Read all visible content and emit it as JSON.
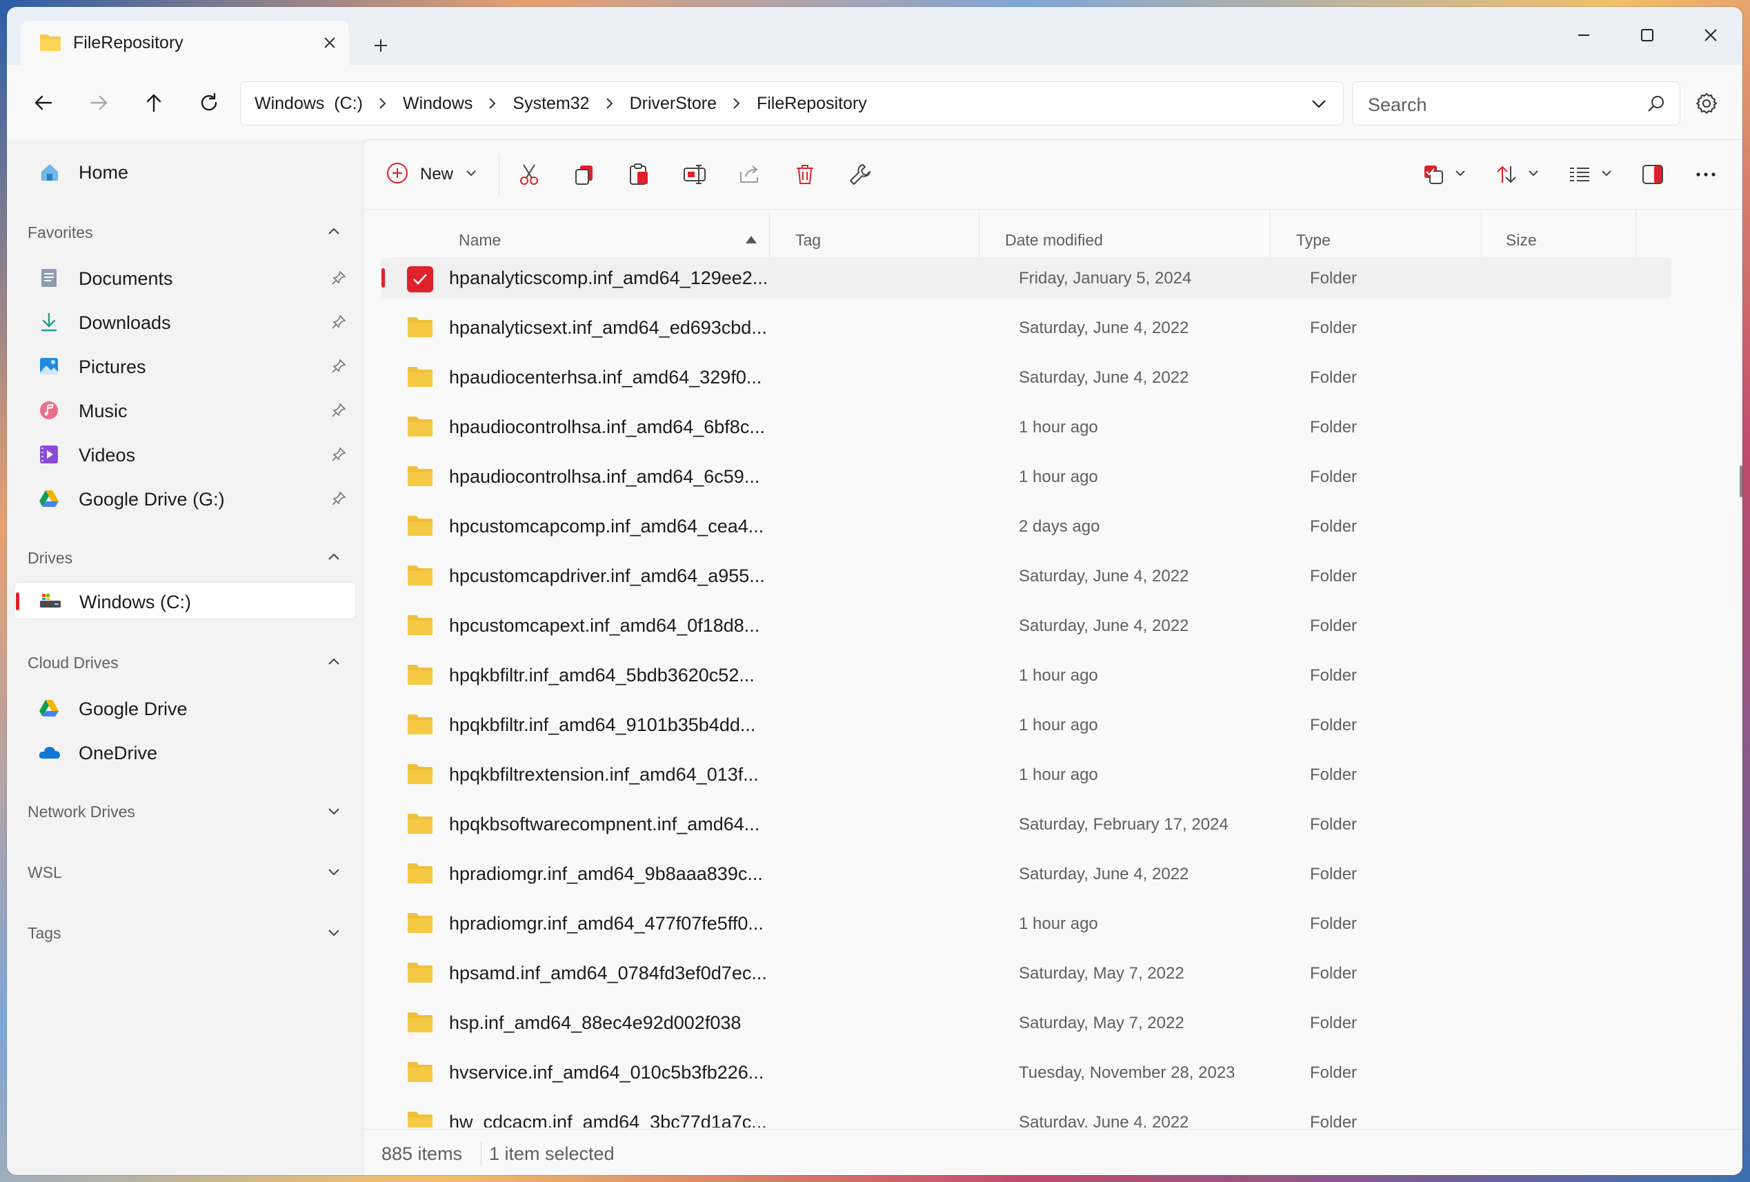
{
  "tab": {
    "title": "FileRepository"
  },
  "address": {
    "crumbs": [
      "Windows  (C:)",
      "Windows",
      "System32",
      "DriverStore",
      "FileRepository"
    ]
  },
  "search": {
    "placeholder": "Search"
  },
  "sidebar": {
    "home": "Home",
    "favorites_title": "Favorites",
    "favorites": [
      {
        "label": "Documents",
        "icon": "documents-icon"
      },
      {
        "label": "Downloads",
        "icon": "downloads-icon"
      },
      {
        "label": "Pictures",
        "icon": "pictures-icon"
      },
      {
        "label": "Music",
        "icon": "music-icon"
      },
      {
        "label": "Videos",
        "icon": "videos-icon"
      },
      {
        "label": "Google Drive (G:)",
        "icon": "google-drive-icon"
      }
    ],
    "drives_title": "Drives",
    "drives": [
      {
        "label": "Windows  (C:)",
        "icon": "drive-icon"
      }
    ],
    "cloud_title": "Cloud Drives",
    "cloud": [
      {
        "label": "Google Drive",
        "icon": "google-drive-icon"
      },
      {
        "label": "OneDrive",
        "icon": "onedrive-icon"
      }
    ],
    "network_title": "Network Drives",
    "wsl_title": "WSL",
    "tags_title": "Tags"
  },
  "toolbar": {
    "new_label": "New"
  },
  "columns": {
    "name": "Name",
    "tag": "Tag",
    "date": "Date modified",
    "type": "Type",
    "size": "Size"
  },
  "files": [
    {
      "name": "hpanalyticscomp.inf_amd64_129ee2...",
      "date": "Friday, January 5, 2024",
      "type": "Folder",
      "selected": true
    },
    {
      "name": "hpanalyticsext.inf_amd64_ed693cbd...",
      "date": "Saturday, June 4, 2022",
      "type": "Folder"
    },
    {
      "name": "hpaudiocenterhsa.inf_amd64_329f0...",
      "date": "Saturday, June 4, 2022",
      "type": "Folder"
    },
    {
      "name": "hpaudiocontrolhsa.inf_amd64_6bf8c...",
      "date": "1 hour ago",
      "type": "Folder"
    },
    {
      "name": "hpaudiocontrolhsa.inf_amd64_6c59...",
      "date": "1 hour ago",
      "type": "Folder"
    },
    {
      "name": "hpcustomcapcomp.inf_amd64_cea4...",
      "date": "2 days ago",
      "type": "Folder"
    },
    {
      "name": "hpcustomcapdriver.inf_amd64_a955...",
      "date": "Saturday, June 4, 2022",
      "type": "Folder"
    },
    {
      "name": "hpcustomcapext.inf_amd64_0f18d8...",
      "date": "Saturday, June 4, 2022",
      "type": "Folder"
    },
    {
      "name": "hpqkbfiltr.inf_amd64_5bdb3620c52...",
      "date": "1 hour ago",
      "type": "Folder"
    },
    {
      "name": "hpqkbfiltr.inf_amd64_9101b35b4dd...",
      "date": "1 hour ago",
      "type": "Folder"
    },
    {
      "name": "hpqkbfiltrextension.inf_amd64_013f...",
      "date": "1 hour ago",
      "type": "Folder"
    },
    {
      "name": "hpqkbsoftwarecompnent.inf_amd64...",
      "date": "Saturday, February 17, 2024",
      "type": "Folder"
    },
    {
      "name": "hpradiomgr.inf_amd64_9b8aaa839c...",
      "date": "Saturday, June 4, 2022",
      "type": "Folder"
    },
    {
      "name": "hpradiomgr.inf_amd64_477f07fe5ff0...",
      "date": "1 hour ago",
      "type": "Folder"
    },
    {
      "name": "hpsamd.inf_amd64_0784fd3ef0d7ec...",
      "date": "Saturday, May 7, 2022",
      "type": "Folder"
    },
    {
      "name": "hsp.inf_amd64_88ec4e92d002f038",
      "date": "Saturday, May 7, 2022",
      "type": "Folder"
    },
    {
      "name": "hvservice.inf_amd64_010c5b3fb226...",
      "date": "Tuesday, November 28, 2023",
      "type": "Folder"
    },
    {
      "name": "hw_cdcacm.inf_amd64_3bc77d1a7c...",
      "date": "Saturday, June 4, 2022",
      "type": "Folder"
    }
  ],
  "status": {
    "items": "885 items",
    "selected": "1 item selected"
  },
  "colors": {
    "accent": "#e0212b",
    "folder": "#f6c945"
  }
}
